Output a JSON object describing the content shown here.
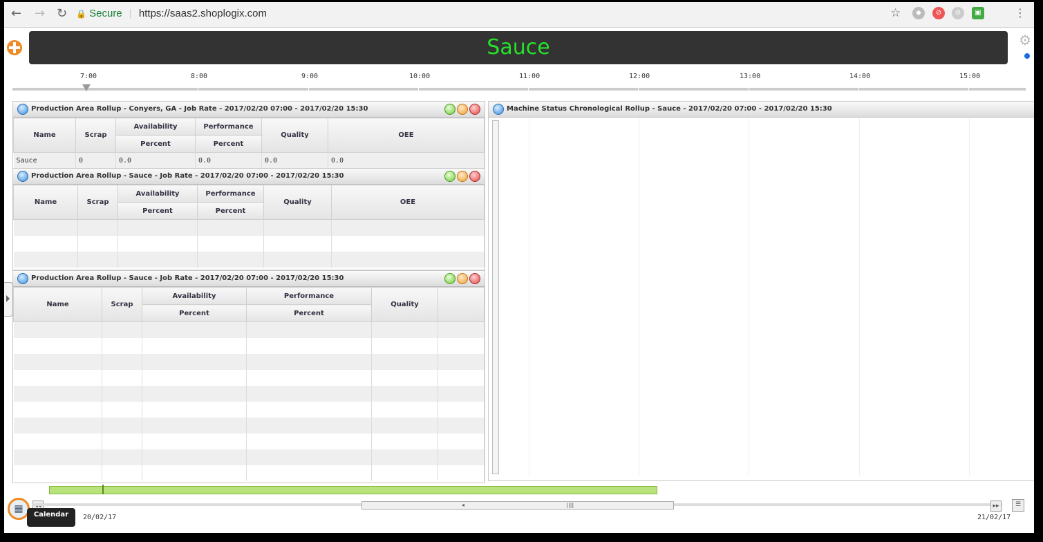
{
  "browser": {
    "secure_label": "Secure",
    "url": "https://saas2.shoplogix.com"
  },
  "app": {
    "title": "Sauce",
    "colors": {
      "title": "#27e12a",
      "header_bg": "#333333",
      "accent": "#f08a24"
    }
  },
  "timeline": {
    "ticks": [
      "7:00",
      "8:00",
      "9:00",
      "10:00",
      "11:00",
      "12:00",
      "13:00",
      "14:00",
      "15:00"
    ]
  },
  "panel1": {
    "title": "Production Area Rollup - Conyers, GA - Job Rate - 2017/02/20 07:00 - 2017/02/20 15:30",
    "headers": {
      "name": "Name",
      "scrap": "Scrap",
      "availability": "Availability",
      "performance": "Performance",
      "quality": "Quality",
      "oee": "OEE",
      "percent": "Percent"
    },
    "row": {
      "name": "Sauce",
      "scrap": "0",
      "availability": "0.0",
      "performance": "0.0",
      "quality": "0.0",
      "oee": "0.0"
    }
  },
  "panel2": {
    "title": "Production Area Rollup - Sauce - Job Rate - 2017/02/20 07:00 - 2017/02/20 15:30",
    "headers": {
      "name": "Name",
      "scrap": "Scrap",
      "availability": "Availability",
      "performance": "Performance",
      "quality": "Quality",
      "oee": "OEE",
      "percent": "Percent"
    }
  },
  "panel3": {
    "title": "Production Area Rollup - Sauce - Job Rate - 2017/02/20 07:00 - 2017/02/20 15:30",
    "headers": {
      "name": "Name",
      "scrap": "Scrap",
      "availability": "Availability",
      "performance": "Performance",
      "quality": "Quality",
      "percent": "Percent"
    }
  },
  "panel4": {
    "title": "Machine Status Chronological Rollup - Sauce - 2017/02/20 07:00 - 2017/02/20 15:30"
  },
  "bottom": {
    "calendar_tooltip": "Calendar",
    "start_date": "20/02/17",
    "end_date": "21/02/17"
  }
}
